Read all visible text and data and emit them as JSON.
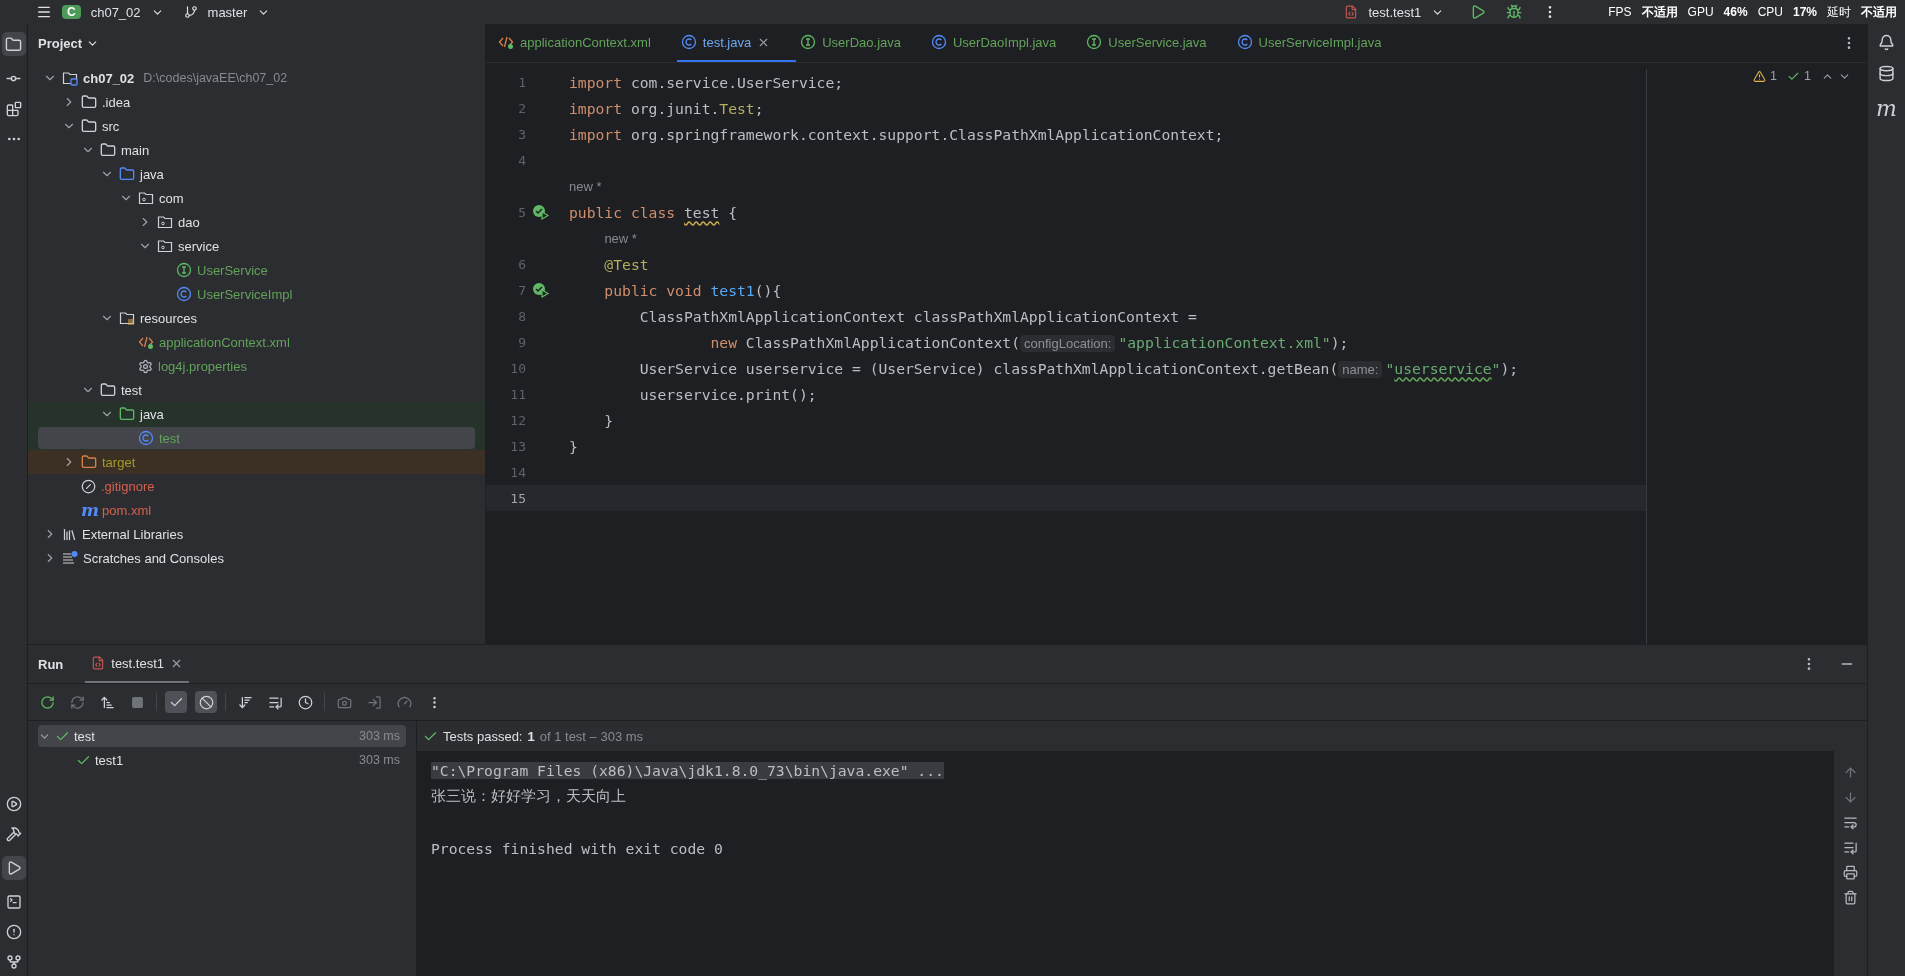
{
  "top_bar": {
    "project_badge": "C",
    "project": "ch07_02",
    "branch": "master",
    "run_config": "test.test1",
    "overlay": [
      {
        "label": "FPS",
        "value": "不适用"
      },
      {
        "label": "GPU",
        "value": "46%"
      },
      {
        "label": "CPU",
        "value": "17%"
      },
      {
        "label": "延时",
        "value": "不适用"
      }
    ]
  },
  "project": {
    "title": "Project",
    "tree": [
      {
        "label": "ch07_02",
        "kind": "module",
        "path": "D:\\codes\\javaEE\\ch07_02",
        "expanded": true,
        "selected": false,
        "children": [
          {
            "label": ".idea",
            "kind": "folder",
            "expanded": false,
            "selected": false
          },
          {
            "label": "src",
            "kind": "folder",
            "expanded": true,
            "selected": false,
            "children": [
              {
                "label": "main",
                "kind": "folder",
                "expanded": true,
                "selected": false,
                "children": [
                  {
                    "label": "java",
                    "kind": "source-root",
                    "expanded": true,
                    "selected": false,
                    "children": [
                      {
                        "label": "com",
                        "kind": "package",
                        "expanded": true,
                        "selected": false,
                        "children": [
                          {
                            "label": "dao",
                            "kind": "package",
                            "expanded": false,
                            "selected": false
                          },
                          {
                            "label": "service",
                            "kind": "package",
                            "expanded": true,
                            "selected": false,
                            "children": [
                              {
                                "label": "UserService",
                                "kind": "interface",
                                "color": "#62a35a",
                                "selected": false
                              },
                              {
                                "label": "UserServiceImpl",
                                "kind": "class",
                                "color": "#62a35a",
                                "selected": false
                              }
                            ]
                          }
                        ]
                      }
                    ]
                  },
                  {
                    "label": "resources",
                    "kind": "resources-root",
                    "expanded": true,
                    "selected": false,
                    "children": [
                      {
                        "label": "applicationContext.xml",
                        "kind": "xml",
                        "color": "#62a35a",
                        "selected": false
                      },
                      {
                        "label": "log4j.properties",
                        "kind": "properties",
                        "color": "#62a35a",
                        "selected": false
                      }
                    ]
                  }
                ]
              },
              {
                "label": "test",
                "kind": "folder",
                "expanded": true,
                "selected": false,
                "children": [
                  {
                    "label": "java",
                    "kind": "test-root",
                    "expanded": true,
                    "selected": false,
                    "children": [
                      {
                        "label": "test",
                        "kind": "class",
                        "color": "#62a35a",
                        "selected": true
                      }
                    ]
                  }
                ]
              }
            ]
          },
          {
            "label": "target",
            "kind": "excluded",
            "expanded": false,
            "color": "#a19a2a",
            "selected": false
          },
          {
            "label": ".gitignore",
            "kind": "ignore",
            "color": "#d3614f",
            "selected": false
          },
          {
            "label": "pom.xml",
            "kind": "maven",
            "icon_text": "m",
            "color": "#d3614f",
            "selected": false
          }
        ]
      },
      {
        "label": "External Libraries",
        "kind": "libraries",
        "expanded": false,
        "selected": false
      },
      {
        "label": "Scratches and Consoles",
        "kind": "scratches",
        "expanded": false,
        "selected": false
      }
    ]
  },
  "editor": {
    "tabs": [
      {
        "label": "applicationContext.xml",
        "kind": "xml",
        "color": "#62a35a",
        "selected": false
      },
      {
        "label": "test.java",
        "kind": "class",
        "color": "#6fa8f0",
        "selected": true
      },
      {
        "label": "UserDao.java",
        "kind": "interface",
        "color": "#62a35a",
        "selected": false
      },
      {
        "label": "UserDaoImpl.java",
        "kind": "class",
        "color": "#62a35a",
        "selected": false
      },
      {
        "label": "UserService.java",
        "kind": "interface",
        "color": "#62a35a",
        "selected": false
      },
      {
        "label": "UserServiceImpl.java",
        "kind": "class",
        "color": "#62a35a",
        "selected": false
      }
    ],
    "inspections": {
      "warnings": "1",
      "passed": "1"
    },
    "lines": [
      {
        "number": "1",
        "tokens": [
          {
            "t": "import ",
            "kind": "keyword"
          },
          {
            "t": "com.service.UserService;",
            "kind": "plain"
          }
        ]
      },
      {
        "number": "2",
        "tokens": [
          {
            "t": "import ",
            "kind": "keyword"
          },
          {
            "t": "org.junit.",
            "kind": "plain"
          },
          {
            "t": "Test",
            "kind": "annotation"
          },
          {
            "t": ";",
            "kind": "plain"
          }
        ]
      },
      {
        "number": "3",
        "tokens": [
          {
            "t": "import ",
            "kind": "keyword"
          },
          {
            "t": "org.springframework.context.support.ClassPathXmlApplicationContext;",
            "kind": "plain"
          }
        ]
      },
      {
        "number": "4"
      },
      {
        "number": "5",
        "hint": "new *",
        "run_marker": true,
        "tokens": [
          {
            "t": "public class ",
            "kind": "keyword"
          },
          {
            "t": "test",
            "kind": "plain",
            "squiggle": true
          },
          {
            "t": " {",
            "kind": "plain"
          }
        ]
      },
      {
        "number": "6",
        "hint": "new *",
        "tokens": [
          {
            "t": "    @Test",
            "kind": "annotation"
          }
        ]
      },
      {
        "number": "7",
        "run_marker": true,
        "tokens": [
          {
            "t": "    public void ",
            "kind": "keyword"
          },
          {
            "t": "test1",
            "kind": "method"
          },
          {
            "t": "(){",
            "kind": "plain"
          }
        ]
      },
      {
        "number": "8",
        "tokens": [
          {
            "t": "        ClassPathXmlApplicationContext classPathXmlApplicationContext =",
            "kind": "plain"
          }
        ]
      },
      {
        "number": "9",
        "tokens": [
          {
            "t": "                new ",
            "kind": "keyword"
          },
          {
            "t": "ClassPathXmlApplicationContext(",
            "kind": "plain"
          },
          {
            "t": "configLocation:",
            "kind": "hint"
          },
          {
            "t": "\"applicationContext.xml\"",
            "kind": "string"
          },
          {
            "t": ");",
            "kind": "plain"
          }
        ]
      },
      {
        "number": "10",
        "tokens": [
          {
            "t": "        UserService userservice = (UserService) classPathXmlApplicationContext.getBean(",
            "kind": "plain"
          },
          {
            "t": "name:",
            "kind": "hint"
          },
          {
            "t": "\"",
            "kind": "string"
          },
          {
            "t": "userservice",
            "kind": "string",
            "squiggle": true
          },
          {
            "t": "\"",
            "kind": "string"
          },
          {
            "t": ");",
            "kind": "plain"
          }
        ]
      },
      {
        "number": "11",
        "tokens": [
          {
            "t": "        userservice.print();",
            "kind": "plain"
          }
        ]
      },
      {
        "number": "12",
        "tokens": [
          {
            "t": "    }",
            "kind": "plain"
          }
        ]
      },
      {
        "number": "13",
        "tokens": [
          {
            "t": "}",
            "kind": "plain"
          }
        ]
      },
      {
        "number": "14"
      },
      {
        "number": "15",
        "current": true
      }
    ]
  },
  "run": {
    "title": "Run",
    "tab": {
      "label": "test.test1",
      "selected": true
    },
    "show_passed": {
      "selected": true
    },
    "show_ignored": {
      "selected": true
    },
    "tests": [
      {
        "label": "test",
        "time": "303 ms",
        "passed": true,
        "expanded": true,
        "selected": true,
        "children": [
          {
            "label": "test1",
            "time": "303 ms",
            "passed": true,
            "selected": false
          }
        ]
      }
    ],
    "summary": {
      "label": "Tests passed:",
      "count": "1",
      "detail": "of 1 test – 303 ms"
    },
    "console": [
      {
        "text": "\"C:\\Program Files (x86)\\Java\\jdk1.8.0_73\\bin\\java.exe\" ...",
        "kind": "command"
      },
      {
        "text": "张三说：好好学习，天天向上",
        "kind": "output"
      },
      {
        "kind": "blank"
      },
      {
        "text": "Process finished with exit code 0",
        "kind": "output"
      }
    ]
  },
  "right_strip": {
    "maven_label": "m"
  }
}
